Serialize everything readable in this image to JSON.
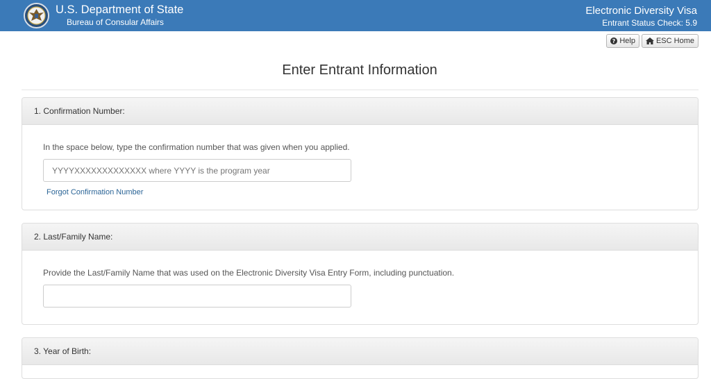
{
  "header": {
    "department": "U.S. Department of State",
    "bureau": "Bureau of Consular Affairs",
    "app_title": "Electronic Diversity Visa",
    "app_subtitle": "Entrant Status Check: 5.9",
    "seal_icon": "department-seal-icon",
    "background_color": "#3b7ab8"
  },
  "toolbar": {
    "help_label": "Help",
    "help_icon": "question-circle-icon",
    "home_label": "ESC Home",
    "home_icon": "home-icon"
  },
  "page": {
    "title": "Enter Entrant Information"
  },
  "sections": [
    {
      "heading": "1. Confirmation Number:",
      "instruction": "In the space below, type the confirmation number that was given when you applied.",
      "input_value": "",
      "input_placeholder": "YYYYXXXXXXXXXXXXX where YYYY is the program year",
      "link_label": "Forgot Confirmation Number"
    },
    {
      "heading": "2. Last/Family Name:",
      "instruction": "Provide the Last/Family Name that was used on the Electronic Diversity Visa Entry Form, including punctuation.",
      "input_value": "",
      "input_placeholder": ""
    },
    {
      "heading": "3. Year of Birth:"
    }
  ]
}
